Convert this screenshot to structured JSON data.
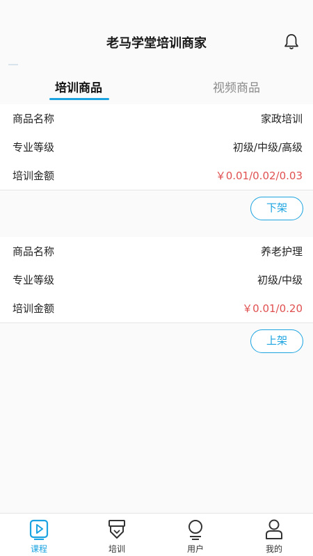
{
  "header": {
    "title": "老马学堂培训商家",
    "bell_icon": "bell-icon"
  },
  "tabs": [
    {
      "label": "培训商品",
      "active": true
    },
    {
      "label": "视频商品",
      "active": false
    }
  ],
  "products": [
    {
      "rows": [
        {
          "label": "商品名称",
          "value": "家政培训"
        },
        {
          "label": "专业等级",
          "value": "初级/中级/高级"
        },
        {
          "label": "培训金额",
          "value": "￥0.01/0.02/0.03"
        }
      ],
      "action_label": "下架"
    },
    {
      "rows": [
        {
          "label": "商品名称",
          "value": "养老护理"
        },
        {
          "label": "专业等级",
          "value": "初级/中级"
        },
        {
          "label": "培训金额",
          "value": "￥0.01/0.20"
        }
      ],
      "action_label": "上架"
    }
  ],
  "bottom_nav": [
    {
      "label": "课程",
      "icon": "course-icon",
      "active": true
    },
    {
      "label": "培训",
      "icon": "training-icon",
      "active": false
    },
    {
      "label": "用户",
      "icon": "user-icon",
      "active": false
    },
    {
      "label": "我的",
      "icon": "profile-icon",
      "active": false
    }
  ],
  "colors": {
    "accent": "#1aa3e0",
    "price": "#e05050"
  }
}
